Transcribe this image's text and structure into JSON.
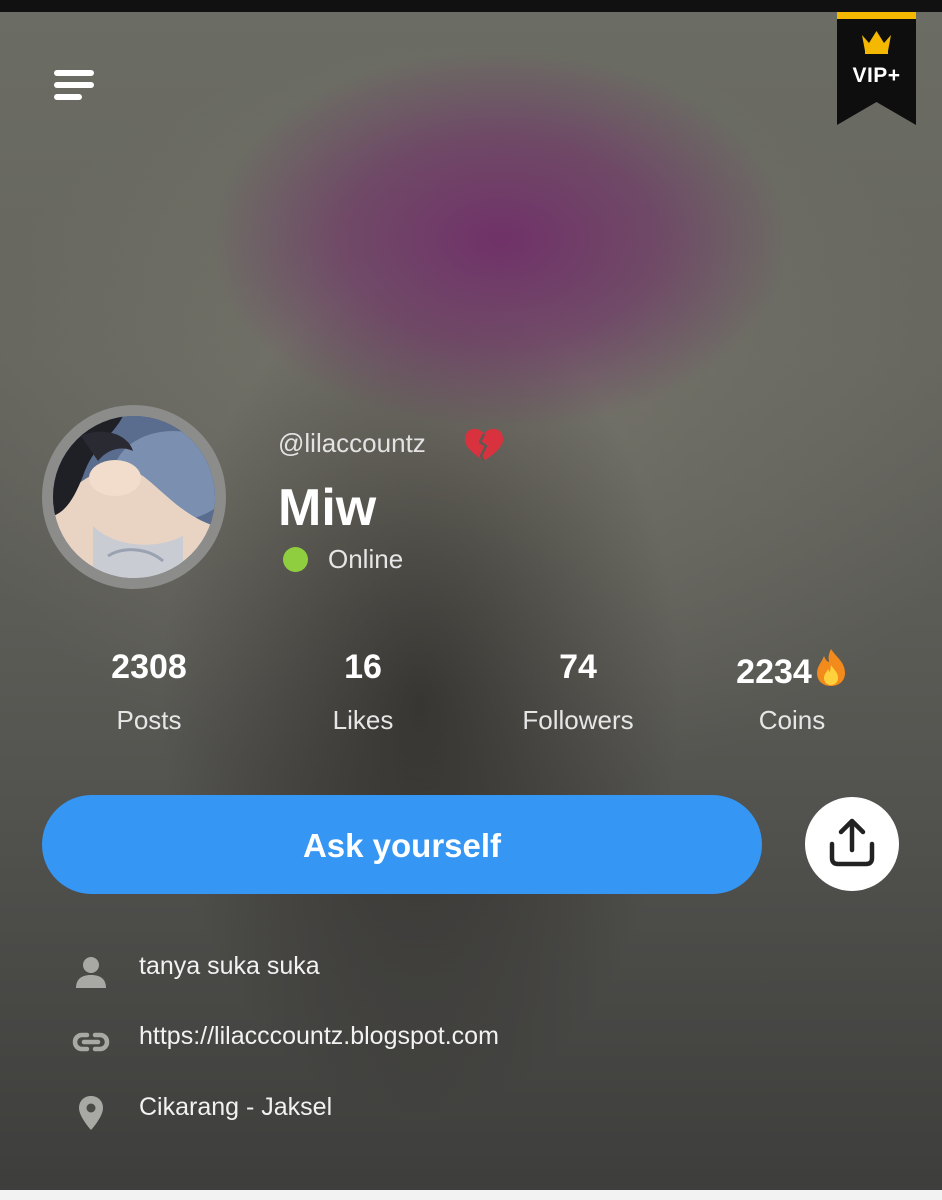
{
  "header": {
    "menu_icon": "menu-icon",
    "vip_badge": {
      "text": "VIP+",
      "icon": "crown-icon",
      "accent": "#f5b800"
    }
  },
  "profile": {
    "username": "@lilaccountz",
    "status_emoji_icon": "broken-heart-icon",
    "display_name": "Miw",
    "online_status": "Online",
    "online_color": "#8fcf3f"
  },
  "stats": [
    {
      "value": "2308",
      "label": "Posts"
    },
    {
      "value": "16",
      "label": "Likes"
    },
    {
      "value": "74",
      "label": "Followers"
    },
    {
      "value": "2234",
      "label": "Coins",
      "icon": "fire-icon"
    }
  ],
  "actions": {
    "ask_label": "Ask yourself",
    "ask_color": "#3596f3",
    "share_icon": "share-icon"
  },
  "info": {
    "bio": "tanya suka suka",
    "website": "https://lilacccountz.blogspot.com",
    "location": "Cikarang - Jaksel"
  }
}
